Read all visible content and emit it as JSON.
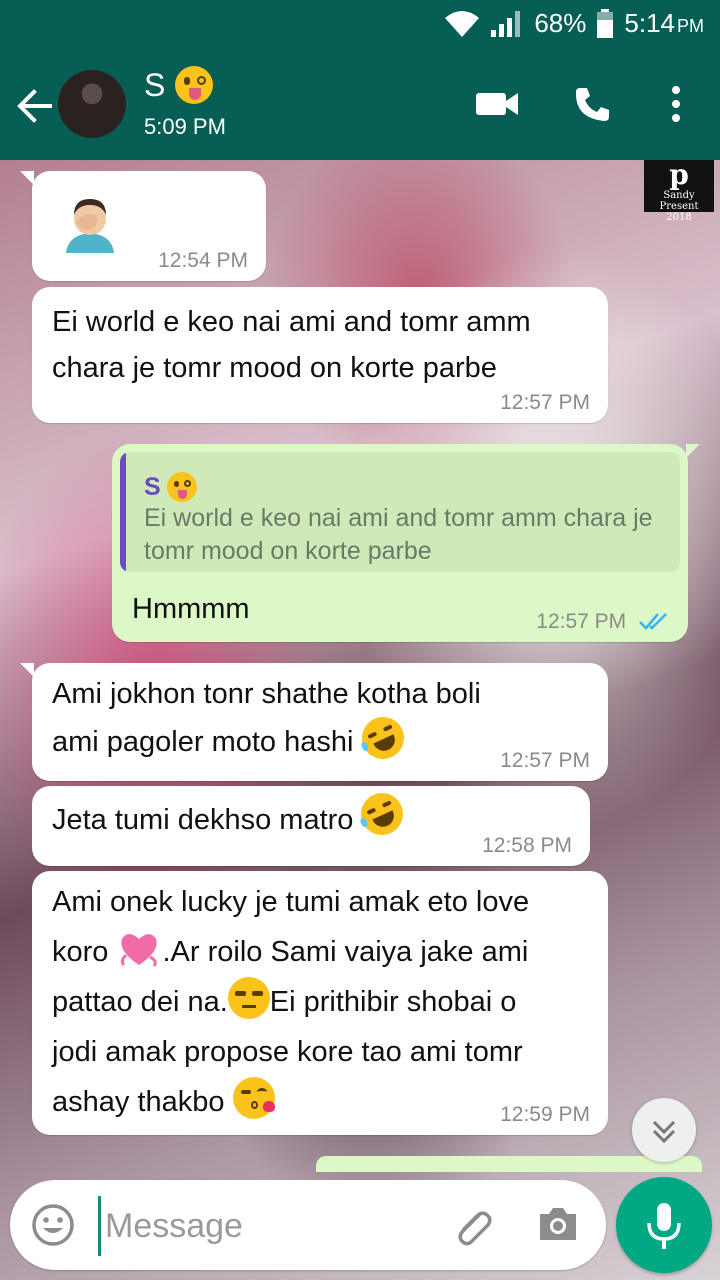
{
  "status_bar": {
    "battery": "68%",
    "time": "5:14",
    "ampm": "PM"
  },
  "header": {
    "contact_name": "S",
    "last_seen": "5:09 PM"
  },
  "messages": [
    {
      "type": "in",
      "text": "",
      "time": "12:54 PM",
      "emoji": "face-palm"
    },
    {
      "type": "in",
      "text": "Ei world e keo nai ami and tomr amm chara je tomr mood on korte parbe",
      "time": "12:57 PM"
    },
    {
      "type": "out",
      "quote_name": "S",
      "quote_text": "Ei world e keo nai ami and tomr amm chara je tomr mood on korte parbe",
      "text": "Hmmmm",
      "time": "12:57 PM",
      "status": "read"
    },
    {
      "type": "in",
      "text_line1": "Ami jokhon tonr shathe kotha boli",
      "text_line2": "ami pagoler moto hashi",
      "time": "12:57 PM"
    },
    {
      "type": "in",
      "text": "Jeta tumi dekhso matro",
      "time": "12:58 PM"
    },
    {
      "type": "in",
      "line1": "Ami onek lucky je tumi amak eto love",
      "line2a": "koro ",
      "line2b": ".Ar roilo Sami vaiya jake ami",
      "line3a": "pattao dei na.",
      "line3b": "Ei prithibir shobai o",
      "line4": "jodi amak propose kore tao ami tomr",
      "line5": "ashay thakbo ",
      "time": "12:59 PM"
    }
  ],
  "watermark": {
    "line1": "Sandy Present",
    "line2": "2018"
  },
  "composer": {
    "placeholder": "Message"
  },
  "colors": {
    "header": "#075e54",
    "outgoing_bubble": "#dcf8c6",
    "mic_button": "#00a884",
    "read_ticks": "#34b7f1"
  }
}
